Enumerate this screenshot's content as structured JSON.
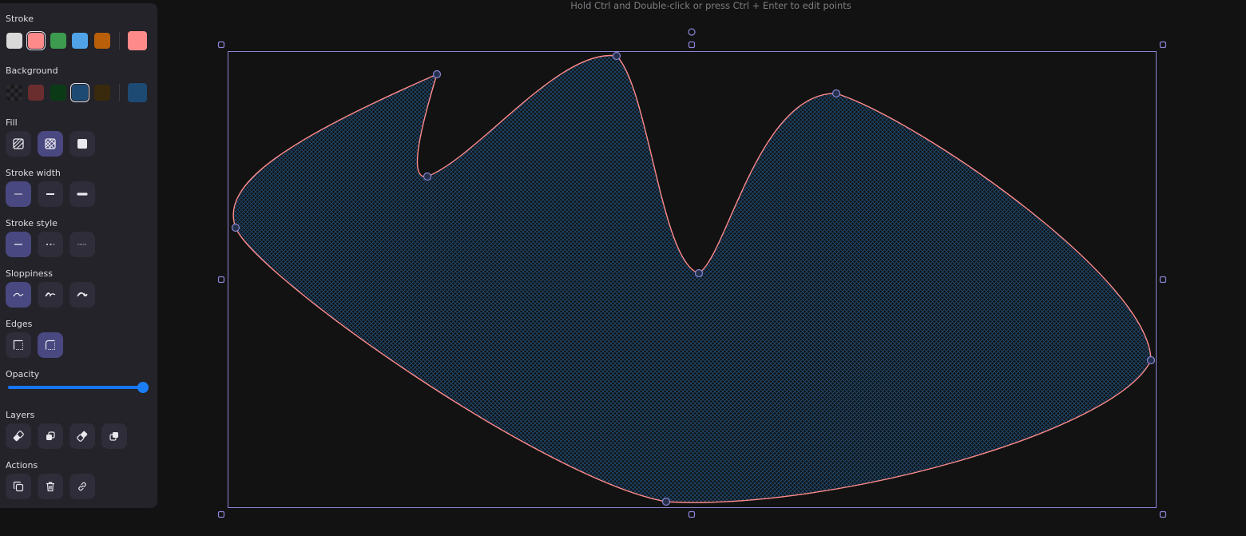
{
  "hint": "Hold Ctrl and Double-click or press Ctrl + Enter to edit points",
  "panel": {
    "stroke": {
      "label": "Stroke",
      "swatches": [
        "#d9d9d9",
        "#ff8a8a",
        "#3c9b4e",
        "#4fa3e6",
        "#b95f0a"
      ],
      "selected_index": 1,
      "current_color": "#ff8a8a"
    },
    "background": {
      "label": "Background",
      "swatches": [
        "transparent",
        "#6b2e2e",
        "#0b3b16",
        "#1d4a73",
        "#3a2a0d"
      ],
      "selected_index": 3,
      "current_color": "#1d4a73"
    },
    "fill": {
      "label": "Fill",
      "options": [
        "hachure",
        "cross-hatch",
        "solid"
      ],
      "active": "cross-hatch"
    },
    "stroke_width": {
      "label": "Stroke width",
      "options": [
        "thin",
        "bold",
        "extra-bold"
      ],
      "active": "thin"
    },
    "stroke_style": {
      "label": "Stroke style",
      "options": [
        "solid",
        "dashed",
        "dotted"
      ],
      "active": "solid"
    },
    "sloppiness": {
      "label": "Sloppiness",
      "options": [
        "architect",
        "artist",
        "cartoonist"
      ],
      "active": "architect"
    },
    "edges": {
      "label": "Edges",
      "options": [
        "sharp",
        "round"
      ],
      "active": "round"
    },
    "opacity": {
      "label": "Opacity",
      "value": 100
    },
    "layers": {
      "label": "Layers",
      "options": [
        "send-to-back",
        "send-backward",
        "bring-forward",
        "bring-to-front"
      ]
    },
    "actions": {
      "label": "Actions",
      "options": [
        "duplicate",
        "delete",
        "link"
      ]
    }
  },
  "canvas": {
    "stroke_color": "#ff8a8a",
    "fill_color": "#1d4a73",
    "selection_color": "#8a85d6"
  }
}
